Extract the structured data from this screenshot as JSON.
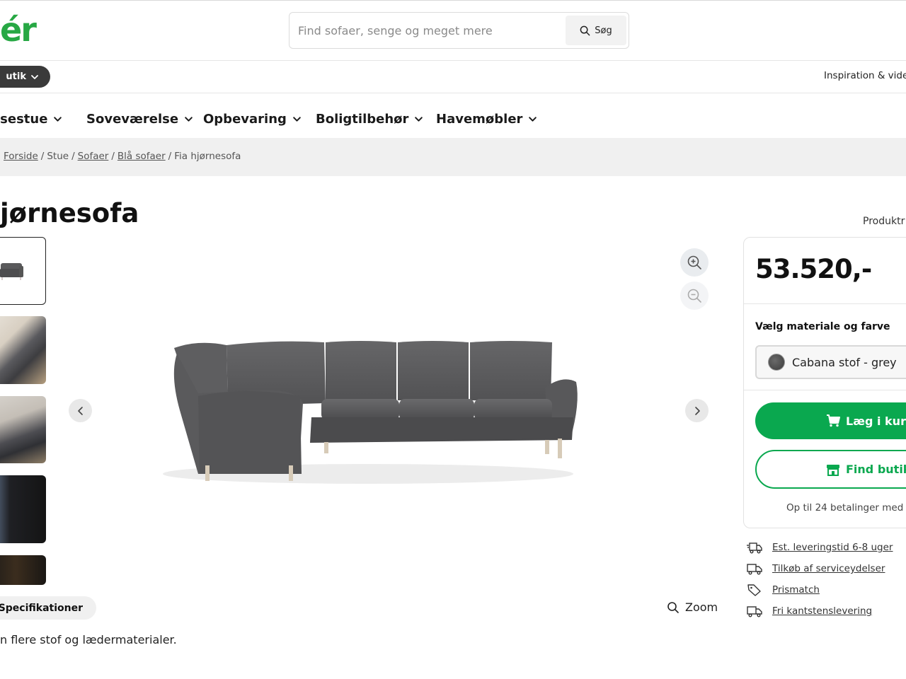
{
  "header": {
    "logo_text": "ér",
    "search_placeholder": "Find sofaer, senge og meget mere",
    "search_button": "Søg",
    "store_pill": "utik",
    "inspiration_link": "Inspiration & vide"
  },
  "nav": {
    "items": [
      {
        "label": "isestue"
      },
      {
        "label": "Soveværelse"
      },
      {
        "label": "Opbevaring"
      },
      {
        "label": "Boligtilbehør"
      },
      {
        "label": "Havemøbler"
      }
    ]
  },
  "breadcrumb": {
    "items": [
      "Forside",
      "Stue",
      "Sofaer",
      "Blå sofaer"
    ],
    "current": "Fia hjørnesofa",
    "separator": "/"
  },
  "product": {
    "title": "jørnesofa",
    "produkt_link": "Produktr",
    "spec_tab": "Specifikationer",
    "zoom_label": "Zoom",
    "description": "n flere stof og lædermaterialer."
  },
  "purchase": {
    "price": "53.520,-",
    "material_label": "Vælg materiale og farve",
    "material_value": "Cabana stof - grey",
    "add_to_cart": "Læg i kurv",
    "find_store": "Find butik",
    "installment": "Op til 24 betalinger med"
  },
  "perks": [
    {
      "label": "Est. leveringstid 6-8 uger",
      "icon": "delivery-truck-icon"
    },
    {
      "label": "Tilkøb af serviceydelser",
      "icon": "truck-icon"
    },
    {
      "label": "Prismatch",
      "icon": "price-tag-icon"
    },
    {
      "label": "Fri kantstenslevering",
      "icon": "truck-icon"
    }
  ],
  "colors": {
    "brand_green": "#27a844",
    "button_green": "#0aa84f",
    "sofa_grey": "#5b5b5d"
  }
}
